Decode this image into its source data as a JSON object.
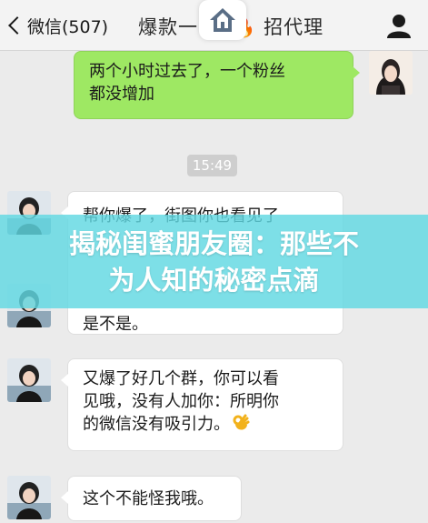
{
  "header": {
    "back_label": "微信(507)",
    "title": "爆款一  发 🔥 招代理",
    "home_icon": "home-icon",
    "profile_icon": "person-icon"
  },
  "messages": [
    {
      "side": "right",
      "bubble_color": "#9ee863",
      "lines": [
        "两个小时过去了，一个粉丝",
        "都没增加"
      ]
    },
    {
      "side": "left",
      "bubble_color": "#ffffff",
      "lines": [
        "帮你爆了，街图你也看见了",
        "是不是。"
      ]
    },
    {
      "side": "left",
      "bubble_color": "#ffffff",
      "lines": [
        "又爆了好几个群，你可以看",
        "见哦，没有人加你：所明你",
        "的微信没有吸引力。"
      ],
      "trailing_emoji": "ok-hand-emoji"
    },
    {
      "side": "left",
      "bubble_color": "#ffffff",
      "lines": [
        "这个不能怪我哦。"
      ]
    }
  ],
  "timestamp": "15:49",
  "banner": {
    "line1": "揭秘闺蜜朋友圈：那些不",
    "line2": "为人知的秘密点滴",
    "color": "#60d8e2"
  }
}
